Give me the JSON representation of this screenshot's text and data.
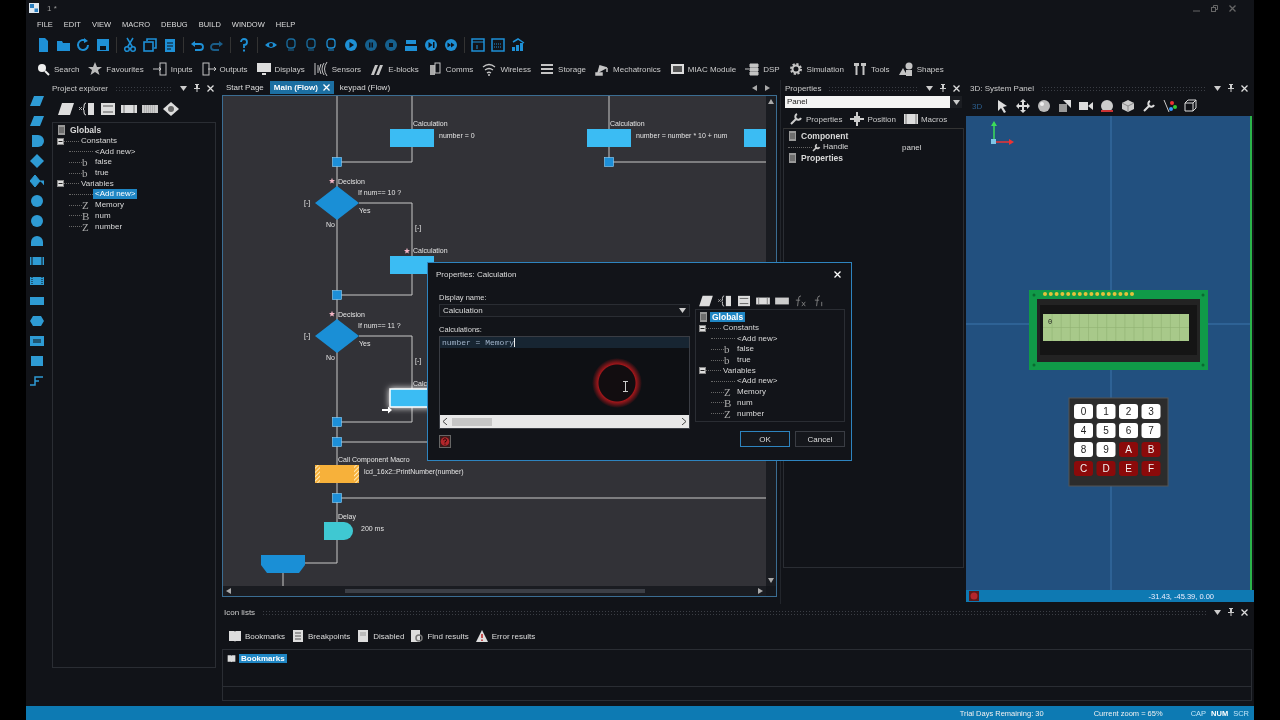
{
  "window": {
    "title": "1 *"
  },
  "menu": [
    "FILE",
    "EDIT",
    "VIEW",
    "MACRO",
    "DEBUG",
    "BUILD",
    "WINDOW",
    "HELP"
  ],
  "component_toolbar": [
    "Search",
    "Favourites",
    "Inputs",
    "Outputs",
    "Displays",
    "Sensors",
    "E-blocks",
    "Comms",
    "Wireless",
    "Storage",
    "Mechatronics",
    "MIAC Module",
    "DSP",
    "Simulation",
    "Tools",
    "Shapes"
  ],
  "project_explorer": {
    "title": "Project explorer",
    "tree": [
      {
        "label": "Globals",
        "selected": false,
        "children": [
          {
            "label": "Constants",
            "expanded": true,
            "selected": false,
            "children": [
              {
                "label": "<Add new>",
                "selected": false
              },
              {
                "glyph": "b",
                "label": "false",
                "selected": false
              },
              {
                "glyph": "b",
                "label": "true",
                "selected": false
              }
            ]
          },
          {
            "label": "Variables",
            "expanded": true,
            "selected": false,
            "children": [
              {
                "label": "<Add new>",
                "selected": true
              },
              {
                "glyph": "Z",
                "label": "Memory",
                "selected": false
              },
              {
                "glyph": "B",
                "label": "num",
                "selected": false
              },
              {
                "glyph": "Z",
                "label": "number",
                "selected": false
              }
            ]
          }
        ]
      }
    ]
  },
  "editor": {
    "tabs": [
      {
        "label": "Start Page",
        "selected": false
      },
      {
        "label": "Main (Flow)",
        "selected": true
      },
      {
        "label": "keypad (Flow)",
        "selected": false
      }
    ],
    "flowchart": {
      "nodes": [
        {
          "kind": "calculation",
          "title": "Calculation",
          "text": "number = 0",
          "starred": false,
          "selected": false
        },
        {
          "kind": "calculation",
          "title": "Calculation",
          "text": "number = number * 10 + num",
          "starred": false,
          "selected": false
        },
        {
          "kind": "calculation",
          "starred": false,
          "selected": false
        },
        {
          "kind": "decision",
          "title": "Decision",
          "text": "If num== 10 ?",
          "yes": "Yes",
          "no": "No",
          "collapse": "[-]",
          "yes_collapse": "[-]",
          "starred": true,
          "selected": false
        },
        {
          "kind": "calculation",
          "title": "Calculation",
          "starred": true,
          "selected": false
        },
        {
          "kind": "decision",
          "title": "Decision",
          "text": "If num== 11 ?",
          "yes": "Yes",
          "no": "No",
          "collapse": "[-]",
          "yes_collapse": "[-]",
          "starred": true,
          "selected": false
        },
        {
          "kind": "calculation",
          "title": "Calc",
          "starred": false,
          "selected": true
        },
        {
          "kind": "component_macro",
          "title": "Call Component Macro",
          "text": "lcd_16x2::PrintNumber(number)",
          "selected": false
        },
        {
          "kind": "delay",
          "title": "Delay",
          "text": "200 ms",
          "selected": false
        },
        {
          "kind": "loop",
          "selected": false
        }
      ]
    }
  },
  "dialog": {
    "title": "Properties: Calculation",
    "display_name_label": "Display name:",
    "display_name": "Calculation",
    "calculations_label": "Calculations:",
    "code": "number = Memory",
    "tree": [
      {
        "label": "Globals",
        "selected": true,
        "children": [
          {
            "label": "Constants",
            "expanded": true,
            "selected": false,
            "children": [
              {
                "label": "<Add new>",
                "selected": false
              },
              {
                "glyph": "b",
                "label": "false",
                "selected": false
              },
              {
                "glyph": "b",
                "label": "true",
                "selected": false
              }
            ]
          },
          {
            "label": "Variables",
            "expanded": true,
            "selected": false,
            "children": [
              {
                "label": "<Add new>",
                "selected": false
              },
              {
                "glyph": "Z",
                "label": "Memory",
                "selected": false
              },
              {
                "glyph": "B",
                "label": "num",
                "selected": false
              },
              {
                "glyph": "Z",
                "label": "number",
                "selected": false
              }
            ]
          }
        ]
      }
    ],
    "buttons": [
      {
        "label": "OK",
        "default": true
      },
      {
        "label": "Cancel",
        "default": false
      }
    ]
  },
  "properties": {
    "title": "Properties",
    "selector": "Panel",
    "tabs": [
      "Properties",
      "Position",
      "Macros"
    ],
    "tree": [
      {
        "label": "Component",
        "children": [
          {
            "label": "Handle",
            "value": "panel"
          }
        ]
      },
      {
        "label": "Properties"
      }
    ]
  },
  "system_panel": {
    "title": "3D: System Panel",
    "mode_label": "3D",
    "lcd_text": "0",
    "keypad": [
      {
        "label": "0",
        "color": "#ffffff"
      },
      {
        "label": "1",
        "color": "#ffffff"
      },
      {
        "label": "2",
        "color": "#ffffff"
      },
      {
        "label": "3",
        "color": "#ffffff"
      },
      {
        "label": "4",
        "color": "#ffffff"
      },
      {
        "label": "5",
        "color": "#ffffff"
      },
      {
        "label": "6",
        "color": "#ffffff"
      },
      {
        "label": "7",
        "color": "#ffffff"
      },
      {
        "label": "8",
        "color": "#ffffff"
      },
      {
        "label": "9",
        "color": "#ffffff"
      },
      {
        "label": "A",
        "color": "#8b0a0a"
      },
      {
        "label": "B",
        "color": "#8b0a0a"
      },
      {
        "label": "C",
        "color": "#8b0a0a"
      },
      {
        "label": "D",
        "color": "#8b0a0a"
      },
      {
        "label": "E",
        "color": "#8b0a0a"
      },
      {
        "label": "F",
        "color": "#8b0a0a"
      }
    ],
    "coordinates": "-31.43, -45.39, 0.00"
  },
  "icon_lists": {
    "title": "Icon lists",
    "tabs": [
      "Bookmarks",
      "Breakpoints",
      "Disabled",
      "Find results",
      "Error results"
    ],
    "items": [
      {
        "label": "Bookmarks",
        "selected": true
      }
    ]
  },
  "status_bar": {
    "trial": "Trial Days Remaining: 30",
    "zoom": "Current zoom = 65%",
    "indicators": [
      {
        "label": "CAP",
        "on": false
      },
      {
        "label": "NUM",
        "on": true
      },
      {
        "label": "SCR",
        "on": false
      }
    ]
  }
}
